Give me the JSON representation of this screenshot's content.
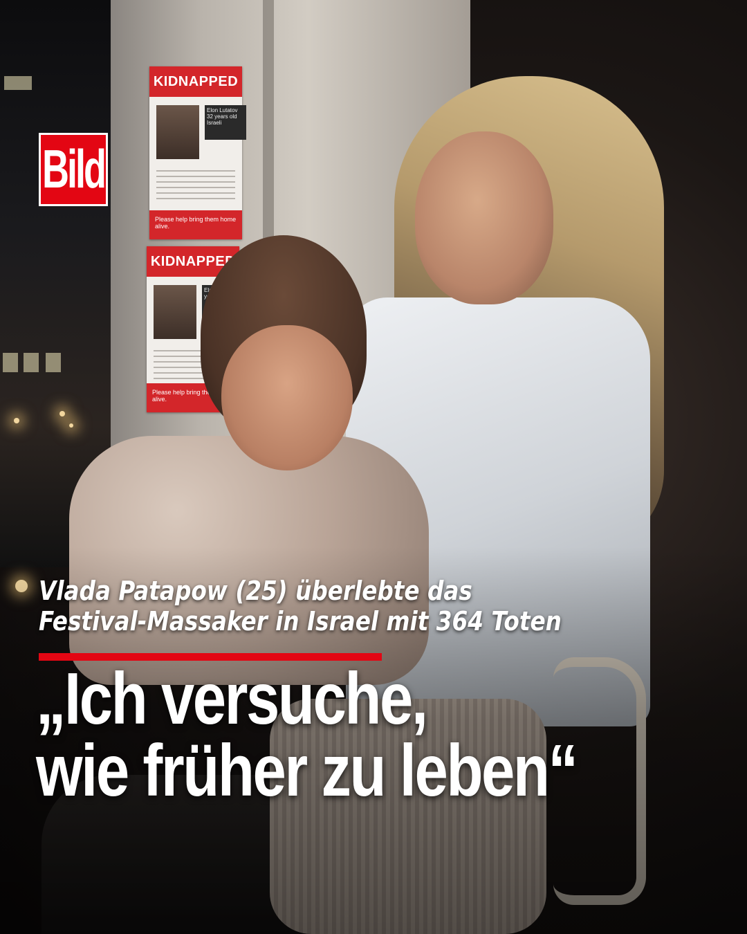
{
  "brand": {
    "logo_text": "Bild",
    "logo_color": "#e30613"
  },
  "posters": [
    {
      "header": "KIDNAPPED",
      "name_text": "Elon Lutatov 32 years old Israeli",
      "footer": "Please help bring them home alive."
    },
    {
      "header": "KIDNAPPED",
      "name_text": "Elan Lev 32 years old",
      "footer": "Please help bring them home alive."
    }
  ],
  "headline": {
    "subline": [
      "Vlada Patapow (25) überlebte das",
      "Festival-Massaker in Israel mit 364 Toten"
    ],
    "quote": [
      "„Ich versuche,",
      "wie früher zu leben“"
    ],
    "accent_color": "#e30613"
  }
}
